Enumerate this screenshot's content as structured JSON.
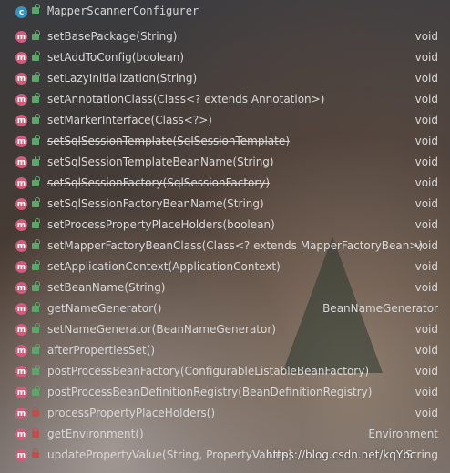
{
  "class_name": "MapperScannerConfigurer",
  "methods": [
    {
      "signature": "setBasePackage(String)",
      "return_type": "void",
      "visibility": "public",
      "deprecated": false
    },
    {
      "signature": "setAddToConfig(boolean)",
      "return_type": "void",
      "visibility": "public",
      "deprecated": false
    },
    {
      "signature": "setLazyInitialization(String)",
      "return_type": "void",
      "visibility": "public",
      "deprecated": false
    },
    {
      "signature": "setAnnotationClass(Class<? extends Annotation>)",
      "return_type": "void",
      "visibility": "public",
      "deprecated": false
    },
    {
      "signature": "setMarkerInterface(Class<?>)",
      "return_type": "void",
      "visibility": "public",
      "deprecated": false
    },
    {
      "signature": "setSqlSessionTemplate(SqlSessionTemplate)",
      "return_type": "void",
      "visibility": "public",
      "deprecated": true
    },
    {
      "signature": "setSqlSessionTemplateBeanName(String)",
      "return_type": "void",
      "visibility": "public",
      "deprecated": false
    },
    {
      "signature": "setSqlSessionFactory(SqlSessionFactory)",
      "return_type": "void",
      "visibility": "public",
      "deprecated": true
    },
    {
      "signature": "setSqlSessionFactoryBeanName(String)",
      "return_type": "void",
      "visibility": "public",
      "deprecated": false
    },
    {
      "signature": "setProcessPropertyPlaceHolders(boolean)",
      "return_type": "void",
      "visibility": "public",
      "deprecated": false
    },
    {
      "signature": "setMapperFactoryBeanClass(Class<? extends MapperFactoryBean>)",
      "return_type": "void",
      "visibility": "public",
      "deprecated": false
    },
    {
      "signature": "setApplicationContext(ApplicationContext)",
      "return_type": "void",
      "visibility": "public",
      "deprecated": false
    },
    {
      "signature": "setBeanName(String)",
      "return_type": "void",
      "visibility": "public",
      "deprecated": false
    },
    {
      "signature": "getNameGenerator()",
      "return_type": "BeanNameGenerator",
      "visibility": "public",
      "deprecated": false
    },
    {
      "signature": "setNameGenerator(BeanNameGenerator)",
      "return_type": "void",
      "visibility": "public",
      "deprecated": false
    },
    {
      "signature": "afterPropertiesSet()",
      "return_type": "void",
      "visibility": "public",
      "deprecated": false
    },
    {
      "signature": "postProcessBeanFactory(ConfigurableListableBeanFactory)",
      "return_type": "void",
      "visibility": "public",
      "deprecated": false
    },
    {
      "signature": "postProcessBeanDefinitionRegistry(BeanDefinitionRegistry)",
      "return_type": "void",
      "visibility": "public",
      "deprecated": false
    },
    {
      "signature": "processPropertyPlaceHolders()",
      "return_type": "void",
      "visibility": "private",
      "deprecated": false
    },
    {
      "signature": "getEnvironment()",
      "return_type": "Environment",
      "visibility": "private",
      "deprecated": false
    },
    {
      "signature": "updatePropertyValue(String, PropertyValues)",
      "return_type": "String",
      "visibility": "private",
      "deprecated": false
    }
  ],
  "watermark": "https://blog.csdn.net/kqYbc",
  "colors": {
    "class_icon": "#3592c4",
    "method_icon": "#d45a7b",
    "public_lock": "#59a869",
    "private_lock": "#c24d4d",
    "text": "#d8d8d8"
  }
}
